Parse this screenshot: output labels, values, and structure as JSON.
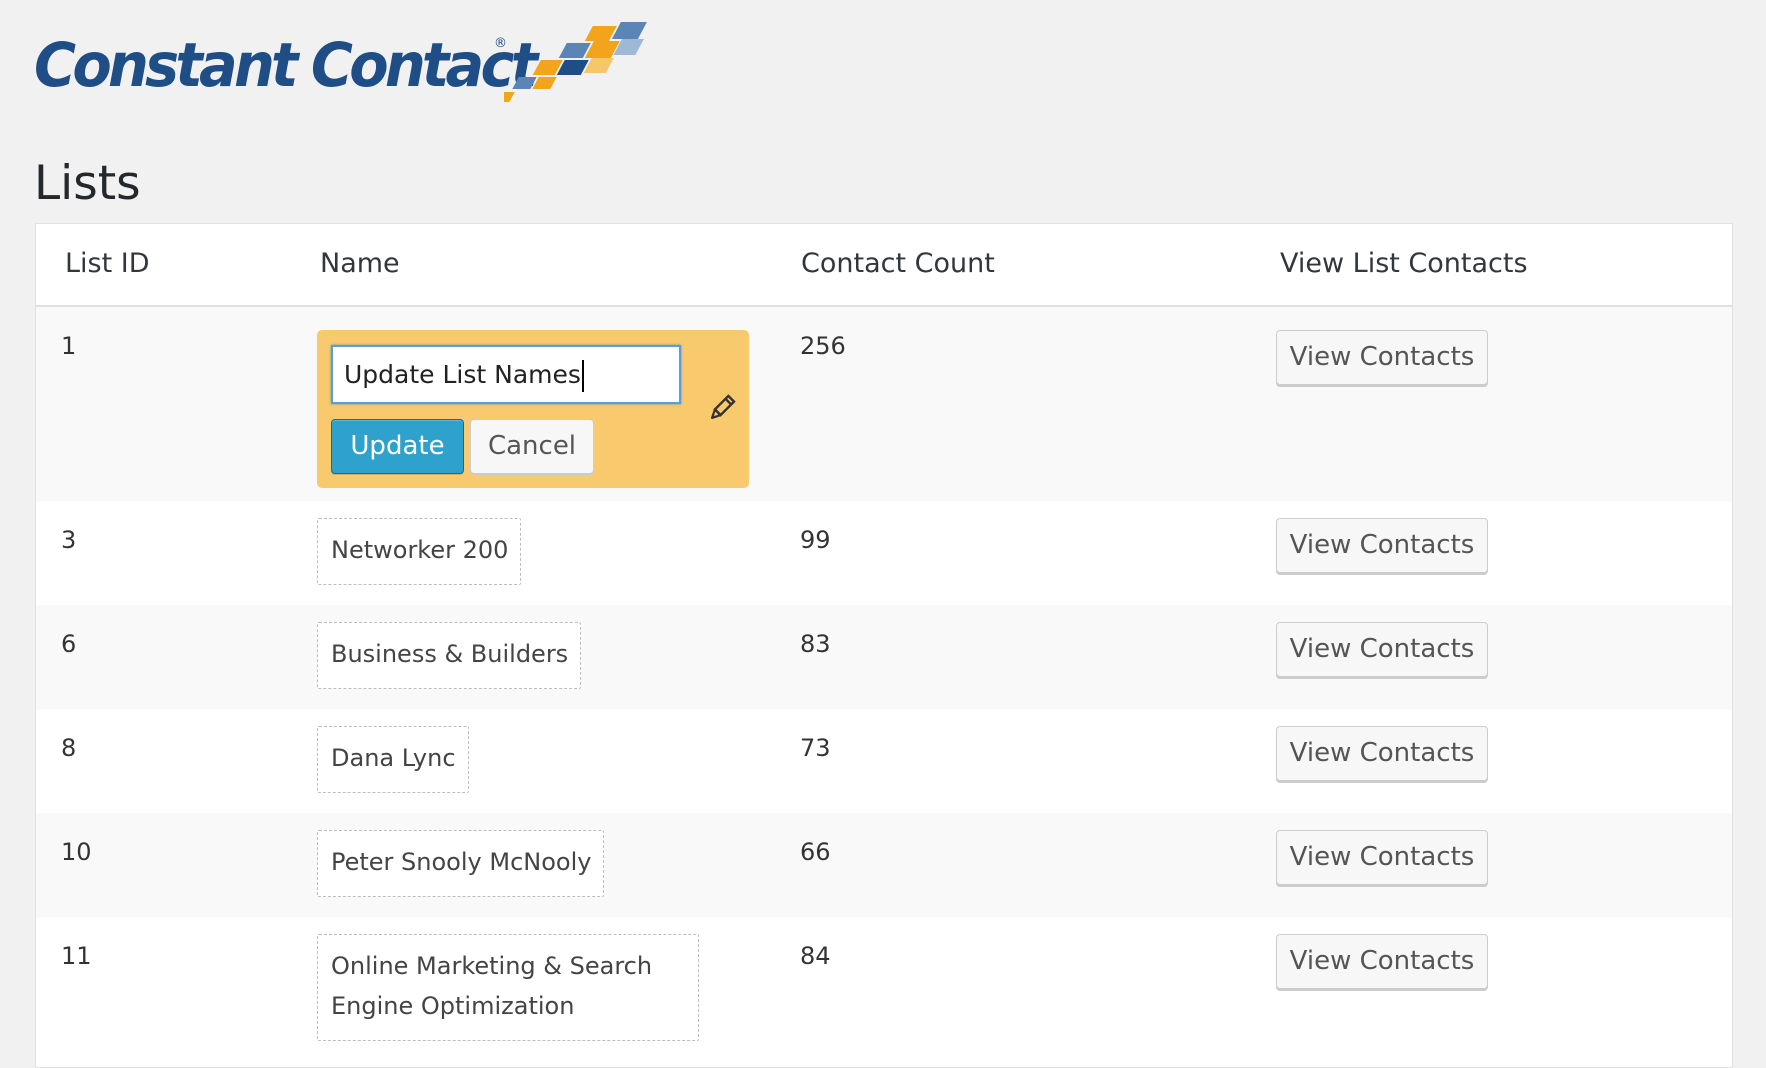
{
  "brand": {
    "logo_text": "Constant Contact",
    "registered_mark": "®",
    "primary_color": "#1f4e86",
    "accent_colors": [
      "#f2a51c",
      "#1f4e86",
      "#5b85b7"
    ]
  },
  "page": {
    "title": "Lists"
  },
  "table": {
    "headers": {
      "list_id": "List ID",
      "name": "Name",
      "contact_count": "Contact Count",
      "view_list_contacts": "View List Contacts"
    },
    "rows": [
      {
        "id": "1",
        "name": "Update List Names",
        "count": "256",
        "button": "View Contacts"
      },
      {
        "id": "3",
        "name": "Networker 200",
        "count": "99",
        "button": "View Contacts"
      },
      {
        "id": "6",
        "name": "Business & Builders",
        "count": "83",
        "button": "View Contacts"
      },
      {
        "id": "8",
        "name": "Dana Lync",
        "count": "73",
        "button": "View Contacts"
      },
      {
        "id": "10",
        "name": "Peter Snooly McNooly",
        "count": "66",
        "button": "View Contacts"
      },
      {
        "id": "11",
        "name_line1": "Online Marketing & Search",
        "name_line2": "Engine Optimization",
        "count": "84",
        "button": "View Contacts"
      }
    ]
  },
  "editor": {
    "input_value": "Update List Names",
    "update_label": "Update",
    "cancel_label": "Cancel",
    "edit_icon": "pencil-icon",
    "background_color": "#f8c96d",
    "update_color": "#2ea2cc"
  }
}
